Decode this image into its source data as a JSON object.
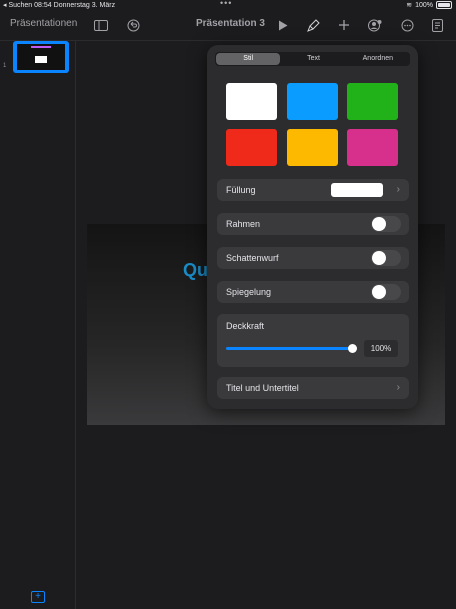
{
  "status_bar": {
    "back_app": "◂ Suchen",
    "time": "08:54",
    "date": "Donnerstag 3. März",
    "dots": "•••",
    "wifi": "≋",
    "battery_percent": "100%"
  },
  "toolbar": {
    "back_label": "Präsentationen",
    "title": "Präsentation 3",
    "icons": {
      "sidebar": "sidebar-icon",
      "undo": "undo-icon",
      "play": "play-icon",
      "format": "paintbrush-icon",
      "add": "plus-icon",
      "collaborate": "collaborate-icon",
      "more": "more-icon",
      "document": "document-icon"
    }
  },
  "sidebar": {
    "slide_number": "1",
    "add_label": "+"
  },
  "slide": {
    "title_fragment": "Qu"
  },
  "popover": {
    "tabs": [
      "Stil",
      "Text",
      "Anordnen"
    ],
    "active_tab": "Stil",
    "swatch_colors": [
      "#ffffff",
      "#0a9cff",
      "#21b21a",
      "#ef2a1a",
      "#fdb900",
      "#d62f8c"
    ],
    "fill_label": "Füllung",
    "fill_color": "#ffffff",
    "border_label": "Rahmen",
    "shadow_label": "Schattenwurf",
    "reflection_label": "Spiegelung",
    "opacity_label": "Deckkraft",
    "opacity_value": "100%",
    "opacity_fraction": 1.0,
    "title_subtitle_label": "Titel und Untertitel",
    "chevron": "›"
  }
}
